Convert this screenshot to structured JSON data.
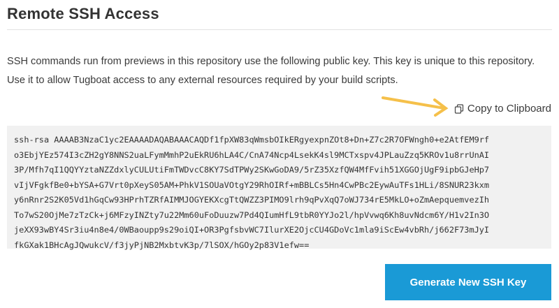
{
  "header": {
    "title": "Remote SSH Access"
  },
  "description": {
    "line1": "SSH commands run from previews in this repository use the following public key. This key is unique to this repository.",
    "line2": "Use it to allow Tugboat access to any external resources required by your build scripts."
  },
  "copy_link": {
    "icon": "copy-icon",
    "label": "Copy to Clipboard"
  },
  "annotation": {
    "icon": "arrow-pointer-icon",
    "color": "#f5c04a"
  },
  "public_key": {
    "lines": [
      "ssh-rsa AAAAB3NzaC1yc2EAAAADAQABAAACAQDf1fpXW83qWmsbOIkERgyexpnZOt8+Dn+Z7c2R7OFWngh0+e2AtfEM9rf",
      "o3EbjYEz574I3cZH2gY8NNS2uaLFymMmhP2uEkRU6hLA4C/CnA74Ncp4LsekK4sl9MCTxspv4JPLauZzq5KROv1u8rrUnAI",
      "3P/Mfh7qI1QQYYztaNZZdxlyCULUtiFmTWDvcC8KY7SdTPWy2SKwGoDA9/5rZ35XzfQW4MfFvih51XGGOjUgF9ipbGJeHp7",
      "vIjVFgkfBe0+bYSA+G7Vrt0pXeyS05AM+PhkV1SOUaVOtgY29RhOIRf+mBBLCs5Hn4CwPBc2EywAuTFs1HLi/8SNUR23kxm",
      "y6nRnr2S2K05Vd1hGqCw93HPrhTZRfAIMMJOGYEKXcgTtQWZZ3PIMO9lrh9qPvXqQ7oWJ734rE5MkLO+oZmAepquemvezIh",
      "To7wS20OjMe7zTzCk+j6MFzyINZty7u22Mm60uFoDuuzw7Pd4QIumHfL9tbR0YYJo2l/hpVvwq6Kh8uvNdcm6Y/H1v2In3O",
      "jeXX93wBY4Sr3iu4n8e4/0WBaoupp9s29oiQI+OR3PgfsbvWC7IlurXE2OjcCU4GDoVc1mla9iScEw4vbRh/j662F73mJyI",
      "fkGXak1BHcAgJQwukcV/f3jyPjNB2MxbtvK3p/7lSOX/hGOy2p83V1efw=="
    ]
  },
  "actions": {
    "generate_label": "Generate New SSH Key",
    "generate_color": "#1a9ad6"
  }
}
